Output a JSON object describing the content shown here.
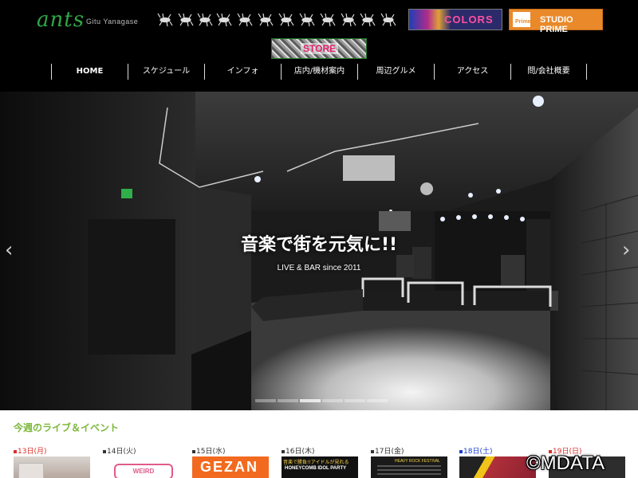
{
  "header": {
    "logo_text": "ants",
    "logo_sub": "Gitu Yanagase",
    "banners": {
      "colors_label": "COLORS",
      "prime_label": "STUDIO PRIME",
      "prime_icon_text": "Prime",
      "store_label": "STORE"
    }
  },
  "nav": {
    "items": [
      {
        "label": "HOME"
      },
      {
        "label": "スケジュール"
      },
      {
        "label": "インフォ"
      },
      {
        "label": "店内/機材案内"
      },
      {
        "label": "周辺グルメ"
      },
      {
        "label": "アクセス"
      },
      {
        "label": "問/会社概要"
      }
    ]
  },
  "hero": {
    "headline": "音楽で街を元気に!!",
    "subline": "LIVE & BAR since 2011",
    "prev_arrow": "‹",
    "next_arrow": "›",
    "slide_count": 6,
    "active_slide": 2
  },
  "events": {
    "title": "今週のライブ＆イベント",
    "days": [
      {
        "label": "13日(月)",
        "color": "red"
      },
      {
        "label": "14日(火)",
        "color": "normal"
      },
      {
        "label": "15日(水)",
        "color": "normal"
      },
      {
        "label": "16日(木)",
        "color": "normal"
      },
      {
        "label": "17日(金)",
        "color": "normal"
      },
      {
        "label": "18日(土)",
        "color": "blue"
      },
      {
        "label": "19日(日)",
        "color": "red"
      }
    ],
    "thumb_texts": {
      "d2": "WEIRD",
      "d3": "GEZAN",
      "d4_top": "音楽で勝負!!アイドルが見れる",
      "d4_mid": "HONEYCOMB IDOL PARTY",
      "d5": "HEAVY ROCK FESTIVAL"
    }
  },
  "watermark": "©MDATA",
  "colors": {
    "accent_green": "#7cb83a",
    "logo_green": "#2fa845",
    "prime_orange": "#e9892a",
    "sunday_red": "#d9302a",
    "saturday_blue": "#1c3fd0"
  }
}
